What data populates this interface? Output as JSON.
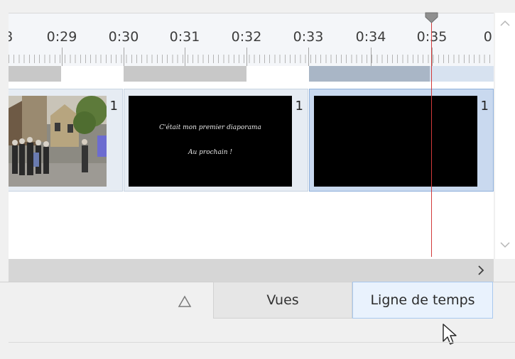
{
  "ruler": {
    "ticks": [
      "8",
      "0:29",
      "0:30",
      "0:31",
      "0:32",
      "0:33",
      "0:34",
      "0:35",
      "0:"
    ]
  },
  "clips": [
    {
      "number": "1",
      "kind": "photo"
    },
    {
      "number": "1",
      "kind": "text-slide",
      "text_line1": "C'était mon premier diaporama",
      "text_line2": "Au prochain !"
    },
    {
      "number": "1",
      "kind": "black-slide"
    }
  ],
  "scroll": {
    "up_icon": "chevron-up",
    "down_icon": "chevron-down",
    "right_icon": "chevron-right"
  },
  "tabs": {
    "collapse_icon": "triangle-up-icon",
    "views_label": "Vues",
    "timeline_label": "Ligne de temps"
  },
  "colors": {
    "playhead": "#d23a3a",
    "selected_tab": "#e9f2fd",
    "selected_clip": "#c9d9ef"
  }
}
